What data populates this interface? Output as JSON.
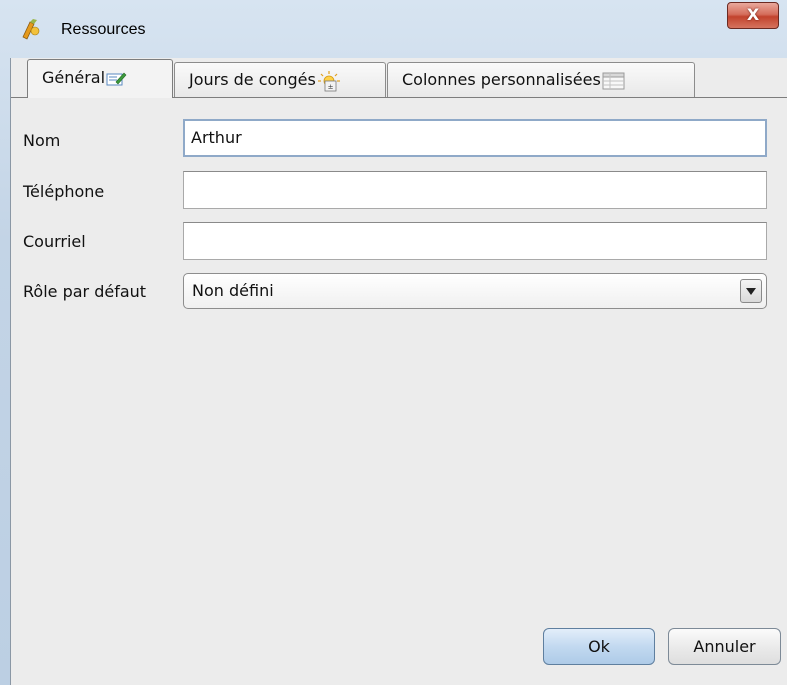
{
  "window": {
    "title": "Ressources",
    "close_label": "X"
  },
  "tabs": [
    {
      "label": "Général",
      "icon": "edit-icon",
      "selected": true
    },
    {
      "label": "Jours de congés",
      "icon": "holiday-sun-icon",
      "selected": false
    },
    {
      "label": "Colonnes personnalisées",
      "icon": "table-columns-icon",
      "selected": false
    }
  ],
  "form": {
    "name": {
      "label": "Nom",
      "value": "Arthur"
    },
    "phone": {
      "label": "Téléphone",
      "value": ""
    },
    "email": {
      "label": "Courriel",
      "value": ""
    },
    "role": {
      "label": "Rôle par défaut",
      "value": "Non défini"
    }
  },
  "buttons": {
    "ok": "Ok",
    "cancel": "Annuler"
  },
  "colors": {
    "selected_button": "#c2d9f0",
    "close_button": "#c2432d",
    "panel_background": "#ececec"
  }
}
